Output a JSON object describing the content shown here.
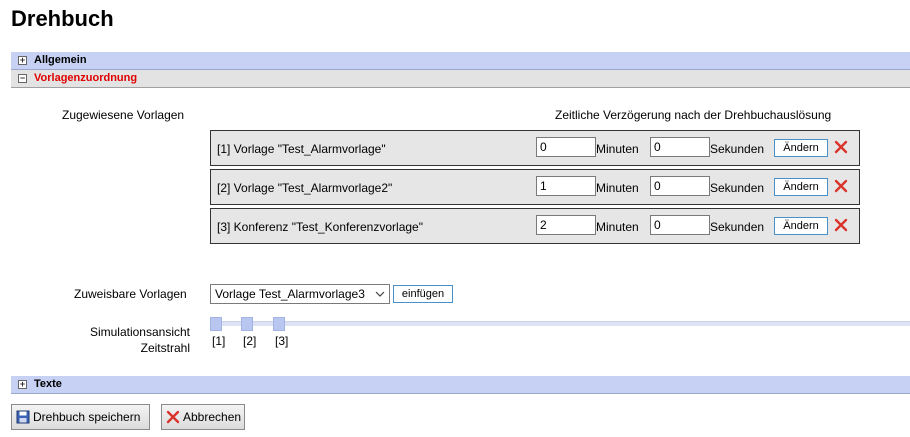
{
  "page": {
    "title": "Drehbuch"
  },
  "sections": {
    "general": {
      "toggle": "+",
      "label": "Allgemein"
    },
    "templates": {
      "toggle": "−",
      "label": "Vorlagenzuordnung"
    },
    "texts": {
      "toggle": "+",
      "label": "Texte"
    }
  },
  "assigned": {
    "label": "Zugewiesene Vorlagen",
    "delay_header": "Zeitliche Verzögerung nach der Drehbuchauslösung",
    "rows": [
      {
        "name": "[1] Vorlage \"Test_Alarmvorlage\"",
        "minutes": "0",
        "seconds": "0",
        "minutes_unit": "Minuten",
        "seconds_unit": "Sekunden",
        "change_label": "Ändern"
      },
      {
        "name": "[2] Vorlage \"Test_Alarmvorlage2\"",
        "minutes": "1",
        "seconds": "0",
        "minutes_unit": "Minuten",
        "seconds_unit": "Sekunden",
        "change_label": "Ändern"
      },
      {
        "name": "[3] Konferenz \"Test_Konferenzvorlage\"",
        "minutes": "2",
        "seconds": "0",
        "minutes_unit": "Minuten",
        "seconds_unit": "Sekunden",
        "change_label": "Ändern"
      }
    ]
  },
  "assignable": {
    "label": "Zuweisbare Vorlagen",
    "selected": "Vorlage Test_Alarmvorlage3",
    "insert_label": "einfügen"
  },
  "simulation": {
    "label_line1": "Simulationsansicht",
    "label_line2": "Zeitstrahl",
    "ticks": [
      "[1]",
      "[2]",
      "[3]"
    ]
  },
  "footer": {
    "save_label": "Drehbuch speichern",
    "cancel_label": "Abbrechen"
  },
  "colors": {
    "section_bar": "#c6d1f3",
    "open_section_text": "#e00000",
    "delete_icon": "#d9342b",
    "button_border": "#4a90c8"
  }
}
